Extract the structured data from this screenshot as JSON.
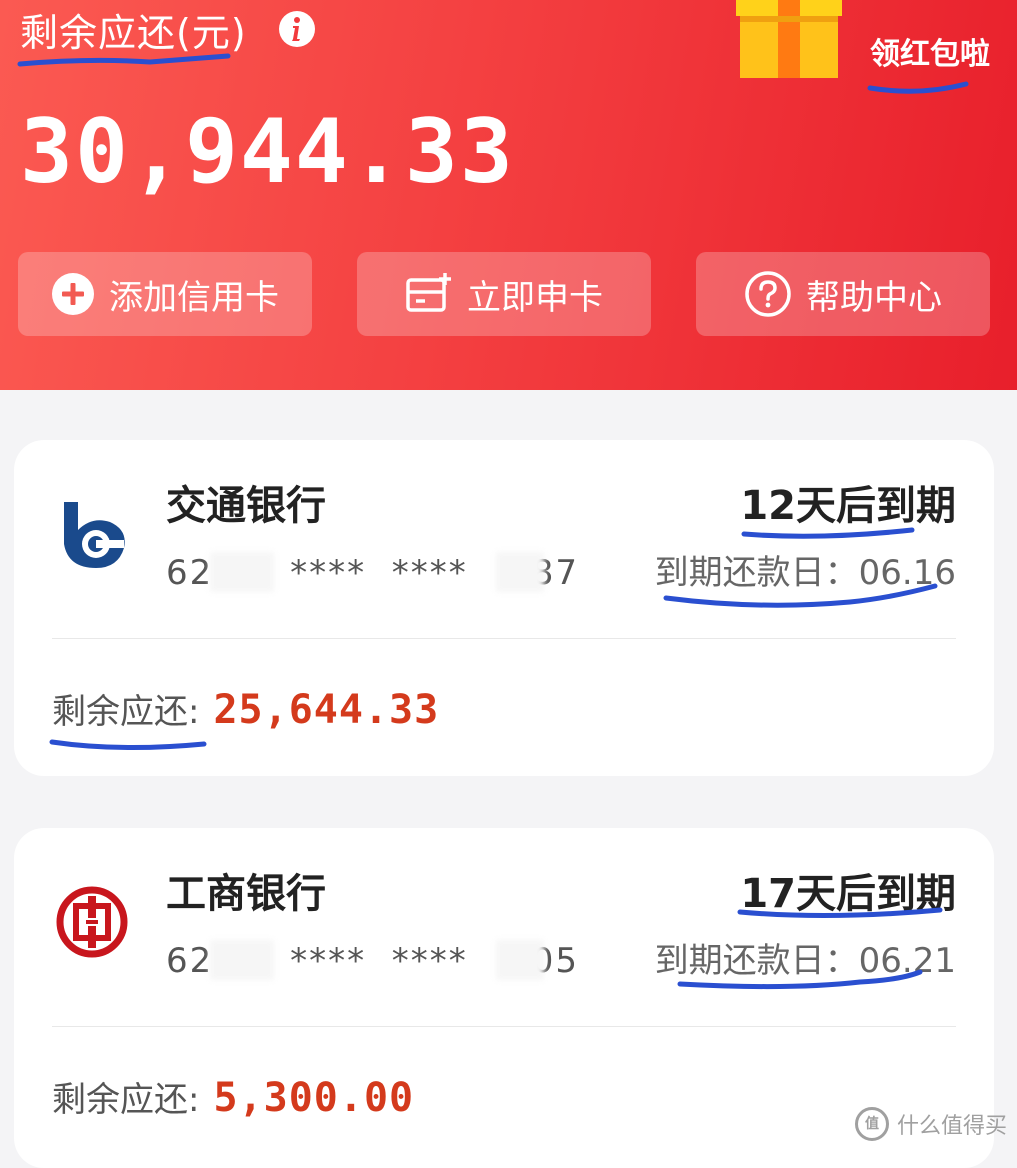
{
  "header": {
    "remain_label": "剩余应还(元)",
    "total_amount": "30,944.33",
    "redpacket_label": "领红包啦",
    "actions": [
      {
        "label": "添加信用卡",
        "icon": "plus-circle-icon"
      },
      {
        "label": "立即申卡",
        "icon": "new-card-icon"
      },
      {
        "label": "帮助中心",
        "icon": "help-circle-icon"
      }
    ],
    "colors": {
      "start": "#fb5a52",
      "end": "#e81f2b"
    }
  },
  "cards": [
    {
      "bank": "交通银行",
      "logo": "bocom-logo-icon",
      "card_number": "62      ****  ****     87",
      "due_in": "12天后到期",
      "due_date": "到期还款日：06.16",
      "remain_label": "剩余应还:",
      "remain_amount": "25,644.33"
    },
    {
      "bank": "工商银行",
      "logo": "icbc-logo-icon",
      "card_number": "62      ****  ****     05",
      "due_in": "17天后到期",
      "due_date": "到期还款日：06.21",
      "remain_label": "剩余应还:",
      "remain_amount": "5,300.00"
    }
  ],
  "watermark": "什么值得买",
  "accent": {
    "amount": "#d43a1c",
    "annotation": "#2a4fd0"
  }
}
